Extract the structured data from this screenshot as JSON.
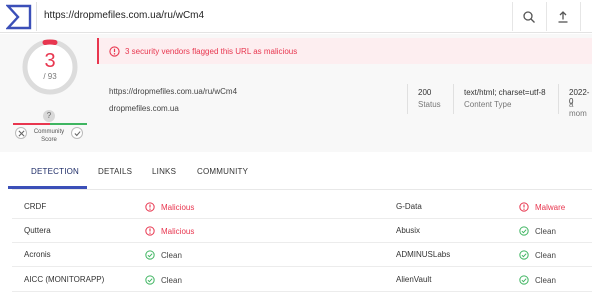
{
  "topbar": {
    "url": "https://dropmefiles.com.ua/ru/wCm4",
    "icons": [
      "search-icon",
      "upload-icon",
      "grid-icon"
    ]
  },
  "score": {
    "detected": "3",
    "total": "/ 93",
    "community_question": "?",
    "community_label": "Community Score"
  },
  "alert": {
    "text": "3 security vendors flagged this URL as malicious"
  },
  "url_info": {
    "url": "https://dropmefiles.com.ua/ru/wCm4",
    "domain": "dropmefiles.com.ua",
    "status_value": "200",
    "status_label": "Status",
    "content_type_value": "text/html; charset=utf-8",
    "content_type_label": "Content Type",
    "date_value": "2022-0",
    "date_label": "a mom"
  },
  "tabs": [
    {
      "label": "DETECTION",
      "active": true
    },
    {
      "label": "DETAILS",
      "active": false
    },
    {
      "label": "LINKS",
      "active": false
    },
    {
      "label": "COMMUNITY",
      "active": false
    }
  ],
  "detections": [
    {
      "left_vendor": "CRDF",
      "left_result": "Malicious",
      "left_type": "malicious",
      "right_vendor": "G-Data",
      "right_result": "Malware",
      "right_type": "malicious"
    },
    {
      "left_vendor": "Quttera",
      "left_result": "Malicious",
      "left_type": "malicious",
      "right_vendor": "Abusix",
      "right_result": "Clean",
      "right_type": "clean"
    },
    {
      "left_vendor": "Acronis",
      "left_result": "Clean",
      "left_type": "clean",
      "right_vendor": "ADMINUSLabs",
      "right_result": "Clean",
      "right_type": "clean"
    },
    {
      "left_vendor": "AICC (MONITORAPP)",
      "left_result": "Clean",
      "left_type": "clean",
      "right_vendor": "AlienVault",
      "right_result": "Clean",
      "right_type": "clean"
    }
  ],
  "colors": {
    "malicious": "#e8364f",
    "clean": "#3fb561",
    "accent": "#3b4fb8"
  }
}
